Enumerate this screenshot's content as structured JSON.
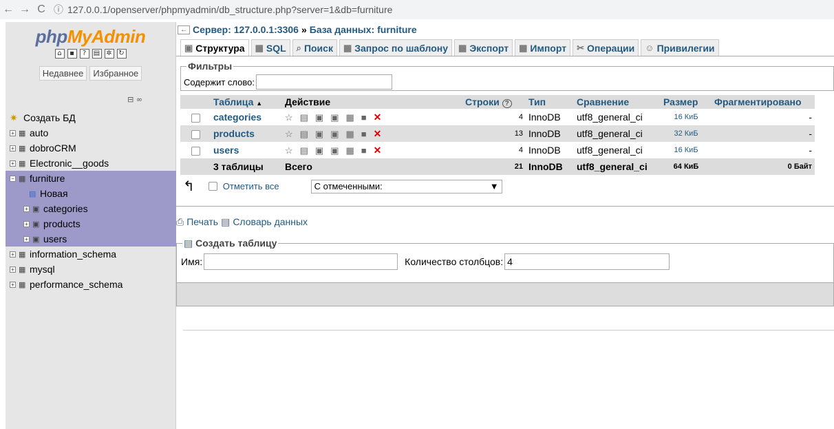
{
  "browser": {
    "url": "127.0.0.1/openserver/phpmyadmin/db_structure.php?server=1&db=furniture",
    "back": "←",
    "forward": "→",
    "reload": "C",
    "security": "ⓘ"
  },
  "sidebar": {
    "logo_php": "php",
    "logo_rest": "MyAdmin",
    "recent": "Недавнее",
    "favorites": "Избранное",
    "tree": [
      {
        "label": "Создать БД",
        "type": "new"
      },
      {
        "label": "auto",
        "type": "db"
      },
      {
        "label": "dobroCRM",
        "type": "db"
      },
      {
        "label": "Electronic__goods",
        "type": "db"
      },
      {
        "label": "furniture",
        "type": "db-open"
      },
      {
        "label": "Новая",
        "type": "sub-new"
      },
      {
        "label": "categories",
        "type": "sub"
      },
      {
        "label": "products",
        "type": "sub"
      },
      {
        "label": "users",
        "type": "sub"
      },
      {
        "label": "information_schema",
        "type": "db"
      },
      {
        "label": "mysql",
        "type": "db"
      },
      {
        "label": "performance_schema",
        "type": "db"
      }
    ]
  },
  "breadcrumb": {
    "server": "Сервер: 127.0.0.1:3306",
    "sep": "»",
    "db": "База данных: furniture"
  },
  "tabs": [
    "Структура",
    "SQL",
    "Поиск",
    "Запрос по шаблону",
    "Экспорт",
    "Импорт",
    "Операции",
    "Привилегии"
  ],
  "filters": {
    "legend": "Фильтры",
    "label": "Содержит слово:"
  },
  "table": {
    "headers": [
      "Таблица",
      "Действие",
      "Строки",
      "Тип",
      "Сравнение",
      "Размер",
      "Фрагментировано"
    ],
    "sort_arrow": "▲",
    "help": "?",
    "rows": [
      {
        "name": "categories",
        "rows": "4",
        "type": "InnoDB",
        "collation": "utf8_general_ci",
        "size": "16 КиБ",
        "frag": "-"
      },
      {
        "name": "products",
        "rows": "13",
        "type": "InnoDB",
        "collation": "utf8_general_ci",
        "size": "32 КиБ",
        "frag": "-"
      },
      {
        "name": "users",
        "rows": "4",
        "type": "InnoDB",
        "collation": "utf8_general_ci",
        "size": "16 КиБ",
        "frag": "-"
      }
    ],
    "footer": {
      "name": "3 таблицы",
      "total": "Всего",
      "rows": "21",
      "type": "InnoDB",
      "collation": "utf8_general_ci",
      "size": "64 КиБ",
      "frag": "0 Байт"
    }
  },
  "bulk": {
    "check_all": "Отметить все",
    "with_selected": "С отмеченными:"
  },
  "links": {
    "print": "Печать",
    "dictionary": "Словарь данных"
  },
  "create": {
    "legend": "Создать таблицу",
    "name_label": "Имя:",
    "columns_label": "Количество столбцов:",
    "columns_value": "4"
  }
}
